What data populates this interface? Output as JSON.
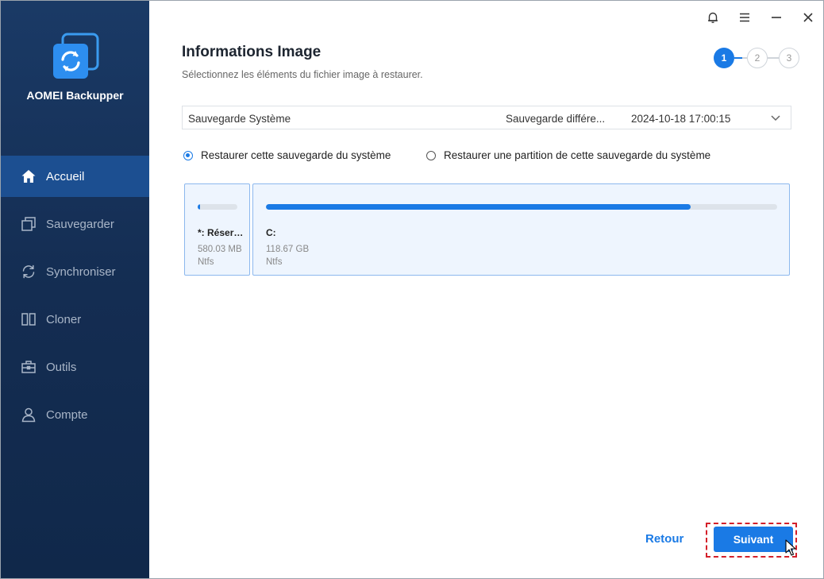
{
  "app": {
    "name": "AOMEI Backupper"
  },
  "sidebar": {
    "items": [
      {
        "label": "Accueil",
        "icon": "home-icon",
        "active": true
      },
      {
        "label": "Sauvegarder",
        "icon": "backup-icon",
        "active": false
      },
      {
        "label": "Synchroniser",
        "icon": "sync-icon",
        "active": false
      },
      {
        "label": "Cloner",
        "icon": "clone-icon",
        "active": false
      },
      {
        "label": "Outils",
        "icon": "tools-icon",
        "active": false
      },
      {
        "label": "Compte",
        "icon": "user-icon",
        "active": false
      }
    ]
  },
  "titlebar": {
    "icons": [
      "bell-icon",
      "menu-icon",
      "minimize-icon",
      "close-icon"
    ]
  },
  "page": {
    "title": "Informations Image",
    "subtitle": "Sélectionnez les éléments du fichier image à restaurer."
  },
  "steps": [
    "1",
    "2",
    "3"
  ],
  "backup_select": {
    "name": "Sauvegarde Système",
    "type": "Sauvegarde différe...",
    "date": "2024-10-18 17:00:15"
  },
  "options": {
    "restore_system": "Restaurer cette sauvegarde du système",
    "restore_partition": "Restaurer une partition de cette sauvegarde du système"
  },
  "partitions": [
    {
      "name": "*: Réservé...",
      "size": "580.03 MB",
      "fs": "Ntfs",
      "used_fraction": 0.05
    },
    {
      "name": "C:",
      "size": "118.67 GB",
      "fs": "Ntfs",
      "used_fraction": 0.83
    }
  ],
  "footer": {
    "back": "Retour",
    "next": "Suivant"
  },
  "colors": {
    "accent": "#1a7ae5",
    "sidebar": "#142d52",
    "highlight": "#d4202a"
  }
}
